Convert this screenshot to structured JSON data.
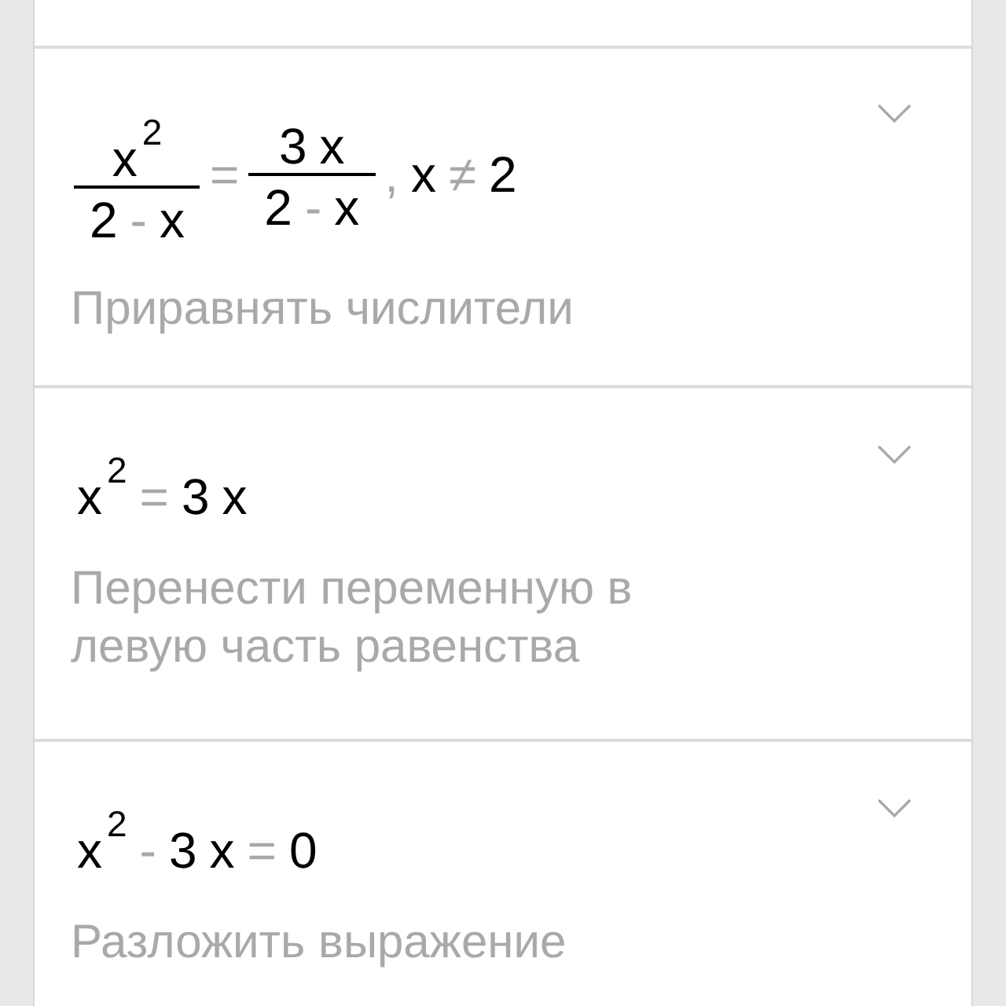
{
  "steps": [
    {
      "expression": [
        {
          "kind": "frac",
          "numerator": [
            {
              "kind": "sym",
              "text": "x"
            },
            {
              "kind": "sup",
              "text": "2"
            }
          ],
          "denominator": [
            {
              "kind": "sym",
              "text": "2"
            },
            {
              "kind": "op",
              "text": "-"
            },
            {
              "kind": "sym",
              "text": "x"
            }
          ]
        },
        {
          "kind": "op",
          "text": "="
        },
        {
          "kind": "frac",
          "numerator": [
            {
              "kind": "sym",
              "text": "3"
            },
            {
              "kind": "sym",
              "text": "x"
            }
          ],
          "denominator": [
            {
              "kind": "sym",
              "text": "2"
            },
            {
              "kind": "op",
              "text": "-"
            },
            {
              "kind": "sym",
              "text": "x"
            }
          ]
        },
        {
          "kind": "op",
          "text": ","
        },
        {
          "kind": "sym",
          "text": "x"
        },
        {
          "kind": "op",
          "text": "≠"
        },
        {
          "kind": "sym",
          "text": "2"
        }
      ],
      "description": "Приравнять числители",
      "expanded": false
    },
    {
      "expression": [
        {
          "kind": "sym",
          "text": "x"
        },
        {
          "kind": "sup",
          "text": "2"
        },
        {
          "kind": "op",
          "text": "="
        },
        {
          "kind": "sym",
          "text": "3"
        },
        {
          "kind": "sym",
          "text": "x"
        }
      ],
      "description": "Перенести переменную в левую часть равенства",
      "expanded": false
    },
    {
      "expression": [
        {
          "kind": "sym",
          "text": "x"
        },
        {
          "kind": "sup",
          "text": "2"
        },
        {
          "kind": "op",
          "text": "-"
        },
        {
          "kind": "sym",
          "text": "3"
        },
        {
          "kind": "sym",
          "text": "x"
        },
        {
          "kind": "op",
          "text": "="
        },
        {
          "kind": "sym",
          "text": "0"
        }
      ],
      "description": "Разложить выражение",
      "expanded": false
    }
  ]
}
